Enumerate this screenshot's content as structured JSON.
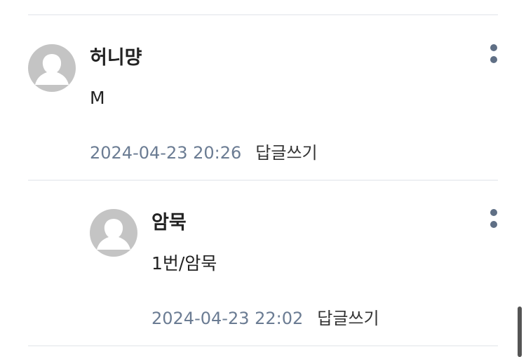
{
  "comments": [
    {
      "author": "허니먕",
      "text": "M",
      "date": "2024-04-23 20:26",
      "reply_label": "답글쓰기",
      "avatar_icon": "default-profile-icon",
      "menu_icon": "more-vertical-icon",
      "is_reply": false
    },
    {
      "author": "암묵",
      "text": "1번/암묵",
      "date": "2024-04-23 22:02",
      "reply_label": "답글쓰기",
      "avatar_icon": "default-profile-icon",
      "menu_icon": "more-vertical-icon",
      "is_reply": true
    }
  ],
  "colors": {
    "date": "#6b7c93",
    "divider": "#eef0f3",
    "menu_dots": "#5f6f85",
    "avatar_bg": "#c4c4c4"
  }
}
